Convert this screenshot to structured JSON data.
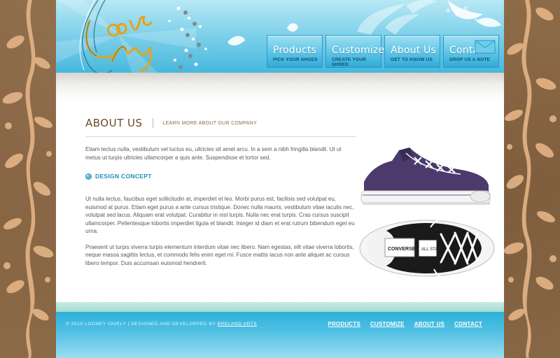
{
  "logo": {
    "line1": "Looney",
    "line2": "lovely"
  },
  "nav": {
    "items": [
      {
        "title": "Products",
        "subtitle": "PICK YOUR SHOES"
      },
      {
        "title": "Customize",
        "subtitle": "CREATE YOUR SHOES"
      },
      {
        "title": "About Us",
        "subtitle": "GET TO KNOW US"
      },
      {
        "title": "Contact",
        "subtitle": "DROP US A NOTE"
      }
    ]
  },
  "about": {
    "title": "ABOUT US",
    "subtitle": "LEARN MORE ABOUT OUR COMPANY",
    "intro": "Etiam lectus nulla, vestibulum vel luctus eu, ultricies sit amet arcu. In a sem a nibh fringilla blandit. Ut ut metus ut turpis ultricies ullamcorper a quis ante. Suspendisse et tortor sed.",
    "section_title": "DESIGN CONCEPT",
    "para2": "Ut nulla lectus, faucibus eget sollicitudin at, imperdiet et leo. Morbi purus est, facilisis sed volutpat eu, euismod at purus. Etiam eget purus a ante cursus tristique. Donec nulla mauris, vestibulum vitae iaculis nec, volutpat sed lacus. Aliquam erat volutpat. Curabitur in nisl turpis. Nulla nec erat turpis. Cras cursus suscipit ullamcorper. Pellentesque lobortis imperdiet ligula et blandit. Integer id diam et erat rutrum bibendum eget eu urna.",
    "para3": "Praesent ut turpis viverra turpis elementum interdum vitae nec libero. Nam egestas, elit vitae viverra lobortis, neque massa sagittis lectus, et commodo felis enim eget mi. Fusce mattis lacus non ante aliquet ac cursus libero tempor. Duis accumsan euismod hendrerit."
  },
  "shoes": {
    "side_brand": "CONVERSE",
    "top_brand": "CONVERSE",
    "top_label": "ALL STAR",
    "colors": {
      "purple": "#4b3a6b",
      "black": "#1a1a1a",
      "sole": "#f4f4f4"
    }
  },
  "footer": {
    "copyright": "© 2010 LOONEY lOVELY  |  DESIGNED AND DEVELOPPED BY ",
    "designer": "BRELAND ARTS",
    "links": [
      "PRODUCTS",
      "CUSTOMIZE",
      "ABOUT US",
      "CONTACT"
    ]
  },
  "colors": {
    "header_blue": "#43b6dc",
    "brown_side": "#8a6845",
    "heading_brown": "#6b4a26",
    "accent_blue": "#1c8fb8"
  },
  "icons": {
    "section": "globe-bullet-icon",
    "contact": "envelope-icon"
  }
}
